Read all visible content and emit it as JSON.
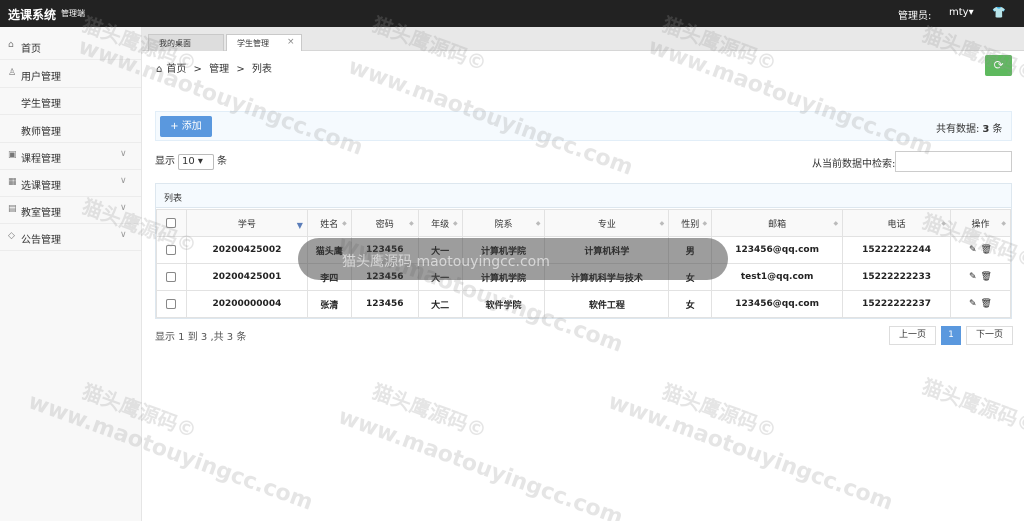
{
  "header": {
    "app_title": "选课系统",
    "app_subtitle": "管理端",
    "admin_label": "管理员:",
    "user_name": "mty",
    "user_chevron": "▾",
    "shirt_icon": "👕"
  },
  "sidebar": {
    "items": [
      {
        "label": "首页",
        "icon": "⌂"
      },
      {
        "label": "用户管理",
        "icon": "♙"
      },
      {
        "label": "学生管理",
        "icon": ""
      },
      {
        "label": "教师管理",
        "icon": ""
      },
      {
        "label": "课程管理",
        "icon": "▣",
        "chev": "∨"
      },
      {
        "label": "选课管理",
        "icon": "▦",
        "chev": "∨"
      },
      {
        "label": "教室管理",
        "icon": "▤",
        "chev": "∨"
      },
      {
        "label": "公告管理",
        "icon": "◇",
        "chev": "∨"
      }
    ]
  },
  "tabs": [
    {
      "label": "我的桌面"
    },
    {
      "label": "学生管理",
      "close": "×"
    }
  ],
  "breadcrumb": {
    "home_icon": "⌂",
    "home": "首页",
    "sep": ">",
    "manage": "管理",
    "list": "列表"
  },
  "refresh_icon": "⟳",
  "toolbar": {
    "add_label": "+ 添加",
    "total_prefix": "共有数据:",
    "total_count": "3",
    "total_suffix": "条"
  },
  "length": {
    "prefix": "显示",
    "value": "10 ▾",
    "suffix": "条"
  },
  "search": {
    "label": "从当前数据中检索:",
    "value": ""
  },
  "table": {
    "title": "列表",
    "headers": [
      "学号",
      "姓名",
      "密码",
      "年级",
      "院系",
      "专业",
      "性别",
      "邮箱",
      "电话",
      "操作"
    ],
    "sort_asc": "▼",
    "sort_both": "◆",
    "rows": [
      [
        "20200425002",
        "猫头鹰",
        "123456",
        "大一",
        "计算机学院",
        "计算机科学",
        "男",
        "123456@qq.com",
        "15222222244"
      ],
      [
        "20200425001",
        "李四",
        "123456",
        "大一",
        "计算机学院",
        "计算机科学与技术",
        "女",
        "test1@qq.com",
        "15222222233"
      ],
      [
        "20200000004",
        "张清",
        "123456",
        "大二",
        "软件学院",
        "软件工程",
        "女",
        "123456@qq.com",
        "15222222237"
      ]
    ],
    "edit_icon": "✎",
    "delete_icon": "🗑"
  },
  "footer": {
    "info": "显示 1 到 3 ,共 3 条",
    "prev": "上一页",
    "page": "1",
    "next": "下一页"
  },
  "watermark": {
    "cn": "猫头鹰源码©",
    "en": "www.maotouyingcc.com"
  },
  "banner_text": "猫头鹰源码 maotouyingcc.com"
}
